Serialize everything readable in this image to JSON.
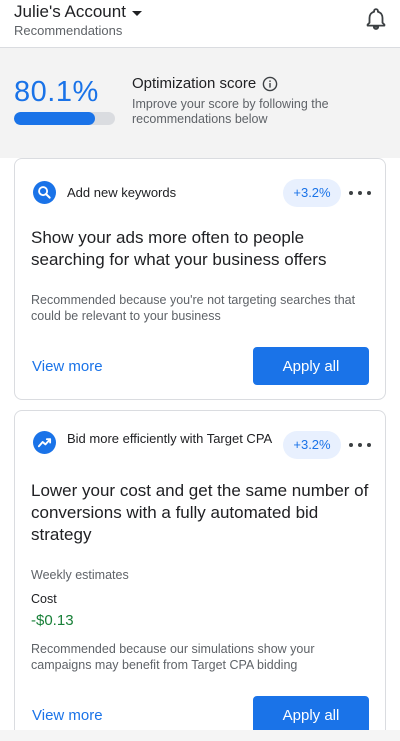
{
  "header": {
    "account_name": "Julie's Account",
    "subtitle": "Recommendations"
  },
  "score": {
    "value_text": "80.1%",
    "progress_fraction": 0.801,
    "title": "Optimization score",
    "description": "Improve your score by following the recommendations below"
  },
  "cards": [
    {
      "icon": "search-icon",
      "type": "Add new keywords",
      "uplift": "+3.2%",
      "heading": "Show your ads more often to people searching for what your business offers",
      "reason": "Recommended because you're not targeting searches that could be relevant to your business",
      "view_more": "View more",
      "apply": "Apply all"
    },
    {
      "icon": "trending-up-icon",
      "type": "Bid more efficiently with Target CPA",
      "uplift": "+3.2%",
      "heading": "Lower your cost and get the same number of conversions with a fully automated bid strategy",
      "estimates_label": "Weekly estimates",
      "cost_label": "Cost",
      "cost_value": "-$0.13",
      "reason": "Recommended because our simulations show your campaigns may benefit from Target CPA bidding",
      "view_more": "View more",
      "apply": "Apply all"
    }
  ],
  "colors": {
    "accent": "#1a73e8",
    "positive": "#188038",
    "chip_bg": "#e8f0fe"
  }
}
